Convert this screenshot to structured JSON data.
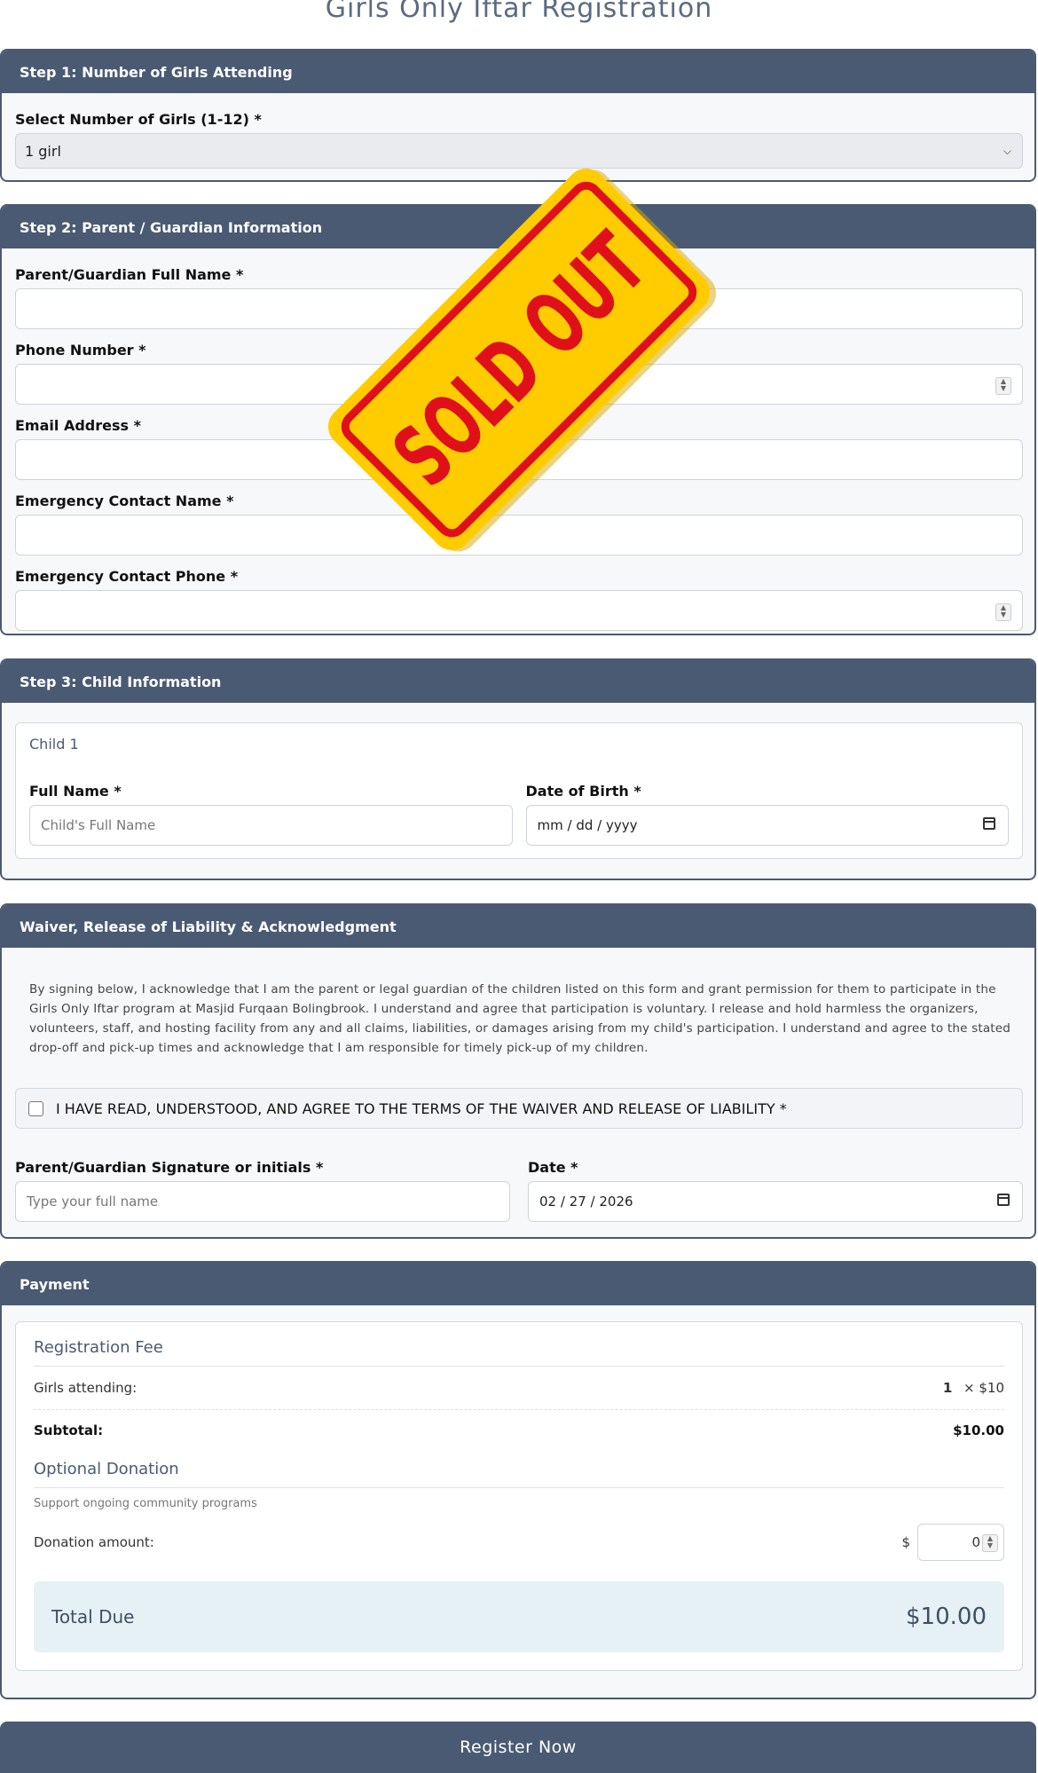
{
  "page_title": "Girls Only Iftar Registration",
  "step1": {
    "header": "Step 1: Number of Girls Attending",
    "label": "Select Number of Girls (1-12) *",
    "selected": "1 girl"
  },
  "step2": {
    "header": "Step 2: Parent / Guardian Information",
    "fields": [
      {
        "label": "Parent/Guardian Full Name *"
      },
      {
        "label": "Phone Number *"
      },
      {
        "label": "Email Address *"
      },
      {
        "label": "Emergency Contact Name *"
      },
      {
        "label": "Emergency Contact Phone *"
      }
    ]
  },
  "step3": {
    "header": "Step 3: Child Information",
    "child_title": "Child 1",
    "name_label": "Full Name *",
    "name_placeholder": "Child's Full Name",
    "dob_label": "Date of Birth *",
    "dob_placeholder": "mm / dd / yyyy"
  },
  "waiver": {
    "header": "Waiver, Release of Liability & Acknowledgment",
    "text": "By signing below, I acknowledge that I am the parent or legal guardian of the children listed on this form and grant permission for them to participate in the Girls Only Iftar program at Masjid Furqaan Bolingbrook. I understand and agree that participation is voluntary. I release and hold harmless the organizers, volunteers, staff, and hosting facility from any and all claims, liabilities, or damages arising from my child's participation. I understand and agree to the stated drop-off and pick-up times and acknowledge that I am responsible for timely pick-up of my children.",
    "agree_label": "I HAVE READ, UNDERSTOOD, AND AGREE TO THE TERMS OF THE WAIVER AND RELEASE OF LIABILITY *",
    "signature_label": "Parent/Guardian Signature or initials *",
    "signature_placeholder": "Type your full name",
    "date_label": "Date *",
    "date_value": "02 / 27 / 2026"
  },
  "payment": {
    "header": "Payment",
    "fee_heading": "Registration Fee",
    "girls_label": "Girls attending:",
    "girls_count": "1",
    "girls_rate": "× $10",
    "subtotal_label": "Subtotal:",
    "subtotal_value": "$10.00",
    "donation_heading": "Optional Donation",
    "donation_sub": "Support ongoing community programs",
    "donation_label": "Donation amount:",
    "donation_currency": "$",
    "donation_value": "0",
    "total_label": "Total Due",
    "total_value": "$10.00"
  },
  "register_label": "Register Now",
  "sold_out": {
    "text": "SOLD OUT",
    "bg": "#ffcc00",
    "text_color": "#e0101a"
  }
}
